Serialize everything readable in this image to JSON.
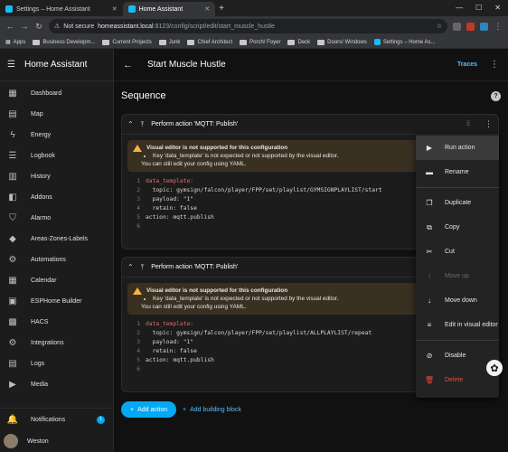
{
  "browser": {
    "tabs": [
      {
        "label": "Settings – Home Assistant",
        "active": false
      },
      {
        "label": "Home Assistant",
        "active": true
      }
    ],
    "new_tab": "+",
    "not_secure": "Not secure",
    "url_host": "homeassistant.local",
    "url_path": ":8123/config/script/edit/start_muscle_hustle",
    "bookmarks": [
      "Apps",
      "Business Developm...",
      "Current Projects",
      "Junk",
      "Chief Architect",
      "Porch/ Foyer",
      "Deck",
      "Doors/ Windows",
      "Settings – Home As..."
    ]
  },
  "sidebar": {
    "title": "Home Assistant",
    "items": [
      {
        "label": "Dashboard",
        "icon": "view-dashboard-icon"
      },
      {
        "label": "Map",
        "icon": "map-icon"
      },
      {
        "label": "Energy",
        "icon": "lightning-icon"
      },
      {
        "label": "Logbook",
        "icon": "logbook-icon"
      },
      {
        "label": "History",
        "icon": "history-icon"
      },
      {
        "label": "Addons",
        "icon": "puzzle-icon"
      },
      {
        "label": "Alarmo",
        "icon": "shield-icon"
      },
      {
        "label": "Areas-Zones-Labels",
        "icon": "tag-icon"
      },
      {
        "label": "Automations",
        "icon": "robot-icon"
      },
      {
        "label": "Calendar",
        "icon": "calendar-icon"
      },
      {
        "label": "ESPHome Builder",
        "icon": "chip-icon"
      },
      {
        "label": "HACS",
        "icon": "hacs-icon"
      },
      {
        "label": "Integrations",
        "icon": "cog-icon"
      },
      {
        "label": "Logs",
        "icon": "logs-icon"
      },
      {
        "label": "Media",
        "icon": "media-icon"
      }
    ],
    "notifications_label": "Notifications",
    "notifications_count": "1",
    "user_name": "Weston"
  },
  "header": {
    "title": "Start Muscle Hustle",
    "traces_label": "Traces"
  },
  "sequence": {
    "title": "Sequence",
    "help": "?",
    "actions": [
      {
        "title": "Perform action 'MQTT: Publish'",
        "warning_title": "Visual editor is not supported for this configuration",
        "warning_item": "Key 'data_template' is not expected or not supported by the visual editor.",
        "warning_note": "You can still edit your config using YAML.",
        "code": [
          {
            "n": "1",
            "text": "data_template:",
            "cls": "k"
          },
          {
            "n": "2",
            "text": "  topic: gymsign/falcon/player/FPP/set/playlist/GYMSIGNPLAYLIST/start",
            "cls": "s"
          },
          {
            "n": "3",
            "text": "  payload: \"1\"",
            "cls": "s"
          },
          {
            "n": "4",
            "text": "  retain: false",
            "cls": "s"
          },
          {
            "n": "5",
            "text": "action: mqtt.publish",
            "cls": "s"
          },
          {
            "n": "6",
            "text": "",
            "cls": "s"
          }
        ]
      },
      {
        "title": "Perform action 'MQTT: Publish'",
        "warning_title": "Visual editor is not supported for this configuration",
        "warning_item": "Key 'data_template' is not expected or not supported by the visual editor.",
        "warning_note": "You can still edit your config using YAML.",
        "code": [
          {
            "n": "1",
            "text": "data_template:",
            "cls": "k"
          },
          {
            "n": "2",
            "text": "  topic: gymsign/falcon/player/FPP/set/playlist/ALLPLAYLIST/repeat",
            "cls": "s"
          },
          {
            "n": "3",
            "text": "  payload: \"1\"",
            "cls": "s"
          },
          {
            "n": "4",
            "text": "  retain: false",
            "cls": "s"
          },
          {
            "n": "5",
            "text": "action: mqtt.publish",
            "cls": "s"
          },
          {
            "n": "6",
            "text": "",
            "cls": "s"
          }
        ]
      }
    ],
    "add_action": "Add action",
    "add_block": "Add building block"
  },
  "context_menu": [
    {
      "label": "Run action",
      "icon": "play-icon",
      "state": "hl"
    },
    {
      "label": "Rename",
      "icon": "rename-icon",
      "state": ""
    },
    {
      "sep": true
    },
    {
      "label": "Duplicate",
      "icon": "duplicate-icon",
      "state": ""
    },
    {
      "label": "Copy",
      "icon": "copy-icon",
      "state": ""
    },
    {
      "label": "Cut",
      "icon": "scissors-icon",
      "state": ""
    },
    {
      "label": "Move up",
      "icon": "arrow-up-icon",
      "state": "dis"
    },
    {
      "label": "Move down",
      "icon": "arrow-down-icon",
      "state": ""
    },
    {
      "label": "Edit in visual editor",
      "icon": "visual-editor-icon",
      "state": ""
    },
    {
      "sep": true
    },
    {
      "label": "Disable",
      "icon": "disable-icon",
      "state": ""
    },
    {
      "label": "Delete",
      "icon": "delete-icon",
      "state": "del"
    }
  ]
}
